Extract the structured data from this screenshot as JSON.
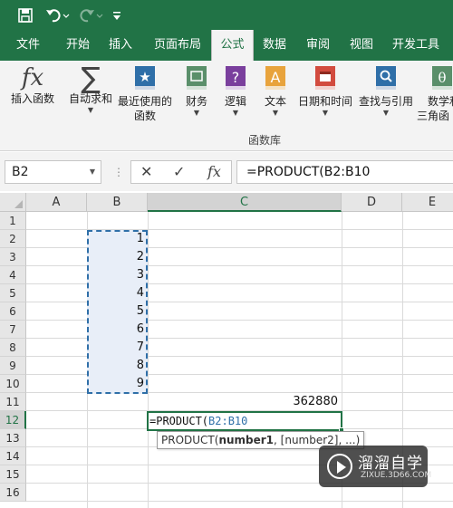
{
  "colors": {
    "brand": "#217346",
    "ribbon_bg": "#f3f3f3",
    "range_fill": "#e8eef8",
    "range_border": "#2f6fa8"
  },
  "qat": {
    "save_icon": "save-icon",
    "undo_icon": "undo-icon",
    "redo_icon": "redo-icon",
    "customize_icon": "customize-icon"
  },
  "tabs": [
    "文件",
    "开始",
    "插入",
    "页面布局",
    "公式",
    "数据",
    "审阅",
    "视图",
    "开发工具"
  ],
  "active_tab": "公式",
  "ribbon": {
    "buttons": [
      {
        "label1": "插入函数",
        "label2": "",
        "icon": "fx-icon"
      },
      {
        "label1": "自动求和",
        "label2": "",
        "icon": "sigma-icon"
      },
      {
        "label1": "最近使用的",
        "label2": "函数",
        "icon": "star-book-icon"
      },
      {
        "label1": "财务",
        "label2": "",
        "icon": "finance-book-icon"
      },
      {
        "label1": "逻辑",
        "label2": "",
        "icon": "question-book-icon"
      },
      {
        "label1": "文本",
        "label2": "",
        "icon": "text-book-icon"
      },
      {
        "label1": "日期和时间",
        "label2": "",
        "icon": "calendar-book-icon"
      },
      {
        "label1": "查找与引用",
        "label2": "",
        "icon": "lookup-book-icon"
      },
      {
        "label1": "数学和",
        "label2": "三角函",
        "icon": "math-book-icon"
      }
    ],
    "group_label": "函数库",
    "fx_glyph": "fx",
    "sigma_glyph": "∑"
  },
  "formula_bar": {
    "name_box": "B2",
    "cancel_glyph": "✕",
    "enter_glyph": "✓",
    "fx_glyph": "fx",
    "formula": "=PRODUCT(B2:B10"
  },
  "sheet": {
    "columns": [
      "A",
      "B",
      "C",
      "D",
      "E"
    ],
    "rows": [
      "1",
      "2",
      "3",
      "4",
      "5",
      "6",
      "7",
      "8",
      "9",
      "10",
      "11",
      "12",
      "13",
      "14",
      "15",
      "16"
    ],
    "b_values": [
      "1",
      "2",
      "3",
      "4",
      "5",
      "6",
      "7",
      "8",
      "9"
    ],
    "c11_value": "362880",
    "edit_prefix": "=PRODUCT(",
    "edit_ref": "B2:B10",
    "tooltip": {
      "func": "PRODUCT(",
      "arg1": "number1",
      "rest": ", [number2], ...)"
    }
  },
  "watermark": {
    "title": "溜溜自学",
    "subtitle": "ZIXUE.3D66.COM"
  }
}
